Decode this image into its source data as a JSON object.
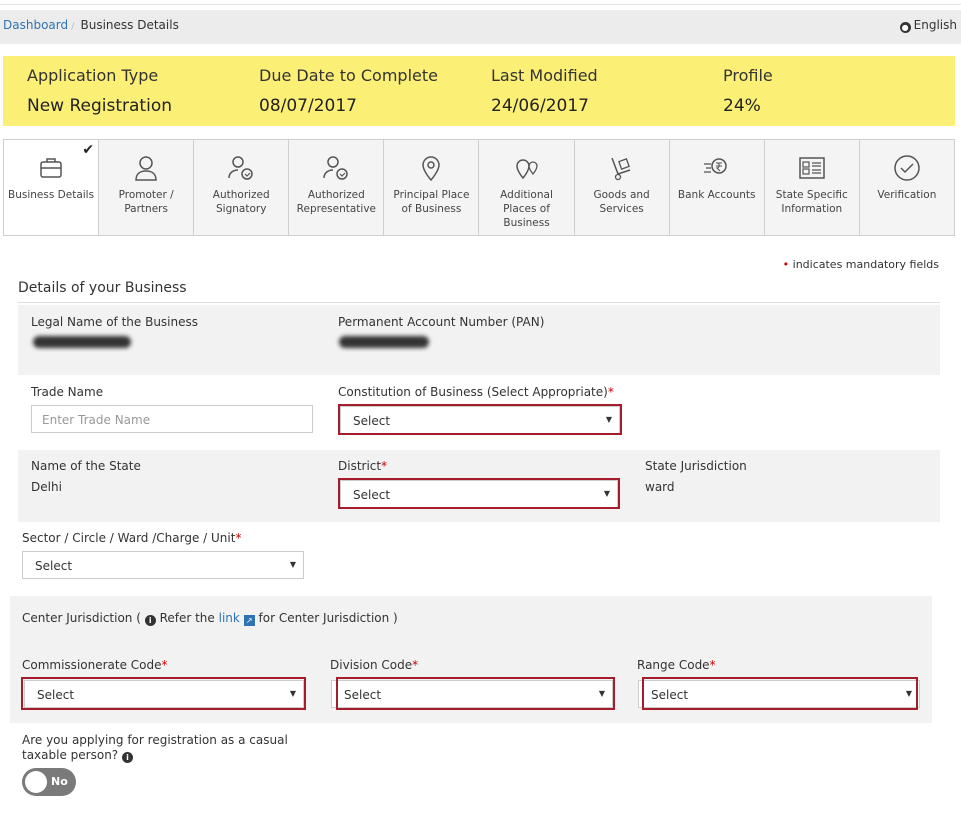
{
  "breadcrumb": {
    "home": "Dashboard",
    "current": "Business Details"
  },
  "language": "English",
  "banner": {
    "application_type_label": "Application Type",
    "application_type": "New Registration",
    "due_date_label": "Due Date to Complete",
    "due_date": "08/07/2017",
    "last_modified_label": "Last Modified",
    "last_modified": "24/06/2017",
    "profile_label": "Profile",
    "profile": "24%"
  },
  "steps": [
    {
      "label": "Business Details",
      "icon": "briefcase-icon",
      "active": true,
      "completed": true
    },
    {
      "label": "Promoter / Partners",
      "icon": "person-icon"
    },
    {
      "label": "Authorized Signatory",
      "icon": "signatory-icon"
    },
    {
      "label": "Authorized Representative",
      "icon": "representative-icon"
    },
    {
      "label": "Principal Place of Business",
      "icon": "map-pin-icon"
    },
    {
      "label": "Additional Places of Business",
      "icon": "multi-pin-icon"
    },
    {
      "label": "Goods and Services",
      "icon": "hand-truck-icon"
    },
    {
      "label": "Bank Accounts",
      "icon": "rupee-icon"
    },
    {
      "label": "State Specific Information",
      "icon": "info-card-icon"
    },
    {
      "label": "Verification",
      "icon": "check-circle-icon"
    }
  ],
  "mandatory_note": "indicates mandatory fields",
  "section_title": "Details of your Business",
  "fields": {
    "legal_name_label": "Legal Name of the Business",
    "pan_label": "Permanent Account Number (PAN)",
    "trade_name_label": "Trade Name",
    "trade_name_placeholder": "Enter Trade Name",
    "constitution_label": "Constitution of Business (Select Appropriate)",
    "constitution_value": "Select",
    "state_label": "Name of the State",
    "state_value": "Delhi",
    "district_label": "District",
    "district_value": "Select",
    "state_jurisdiction_label": "State Jurisdiction",
    "state_jurisdiction_value": "ward",
    "sector_label": "Sector / Circle / Ward /Charge / Unit",
    "sector_value": "Select",
    "center_jurisdiction_prefix": "Center Jurisdiction (",
    "center_jurisdiction_refer": "Refer the",
    "center_jurisdiction_link": "link",
    "center_jurisdiction_suffix": "for Center Jurisdiction )",
    "commissionerate_label": "Commissionerate Code",
    "commissionerate_value": "Select",
    "division_label": "Division Code",
    "division_value": "Select",
    "range_label": "Range Code",
    "range_value": "Select",
    "casual_question": "Are you applying for registration as a casual taxable person?",
    "casual_toggle": "No"
  },
  "colors": {
    "banner": "#fbef75",
    "link": "#2f73b3",
    "highlight": "#a51c2b",
    "mandatory": "#cc0000"
  }
}
